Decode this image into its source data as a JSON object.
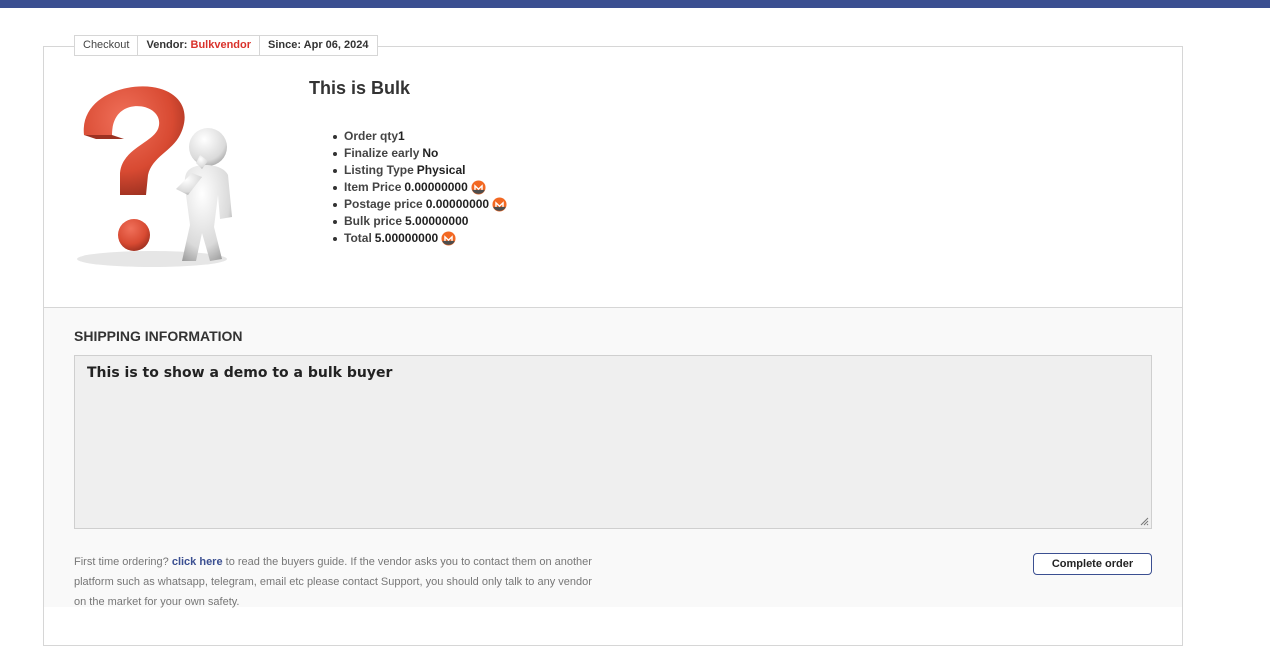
{
  "colors": {
    "topbar": "#3b4f91",
    "vendor": "#d9322b",
    "link": "#3b4f91",
    "xmr_orange": "#f26822"
  },
  "tabs": {
    "checkout": "Checkout",
    "vendor_label": "Vendor:",
    "vendor_name": "Bulkvendor",
    "since": "Since: Apr 06, 2024"
  },
  "product": {
    "image_icon": "question-mark-person-icon",
    "title": "This is Bulk",
    "details": [
      {
        "key": "Order qty",
        "value": "1",
        "currency": false
      },
      {
        "key": "Finalize early",
        "value": "No",
        "currency": false
      },
      {
        "key": "Listing Type",
        "value": "Physical",
        "currency": false
      },
      {
        "key": "Item Price",
        "value": "0.00000000",
        "currency": true
      },
      {
        "key": "Postage price",
        "value": "0.00000000",
        "currency": true
      },
      {
        "key": "Bulk price",
        "value": "5.00000000",
        "currency": false
      },
      {
        "key": "Total",
        "value": "5.00000000",
        "currency": true
      }
    ],
    "currency_icon": "monero-icon"
  },
  "shipping": {
    "title": "SHIPPING INFORMATION",
    "text": "This is to show a demo to a bulk buyer"
  },
  "footer": {
    "note_prefix": "First time ordering?",
    "note_link": "click here",
    "note_suffix": "to read the buyers guide. If the vendor asks you to contact them on another platform such as whatsapp, telegram, email etc please contact Support, you should only talk to any vendor on the market for your own safety.",
    "complete_button": "Complete order"
  }
}
